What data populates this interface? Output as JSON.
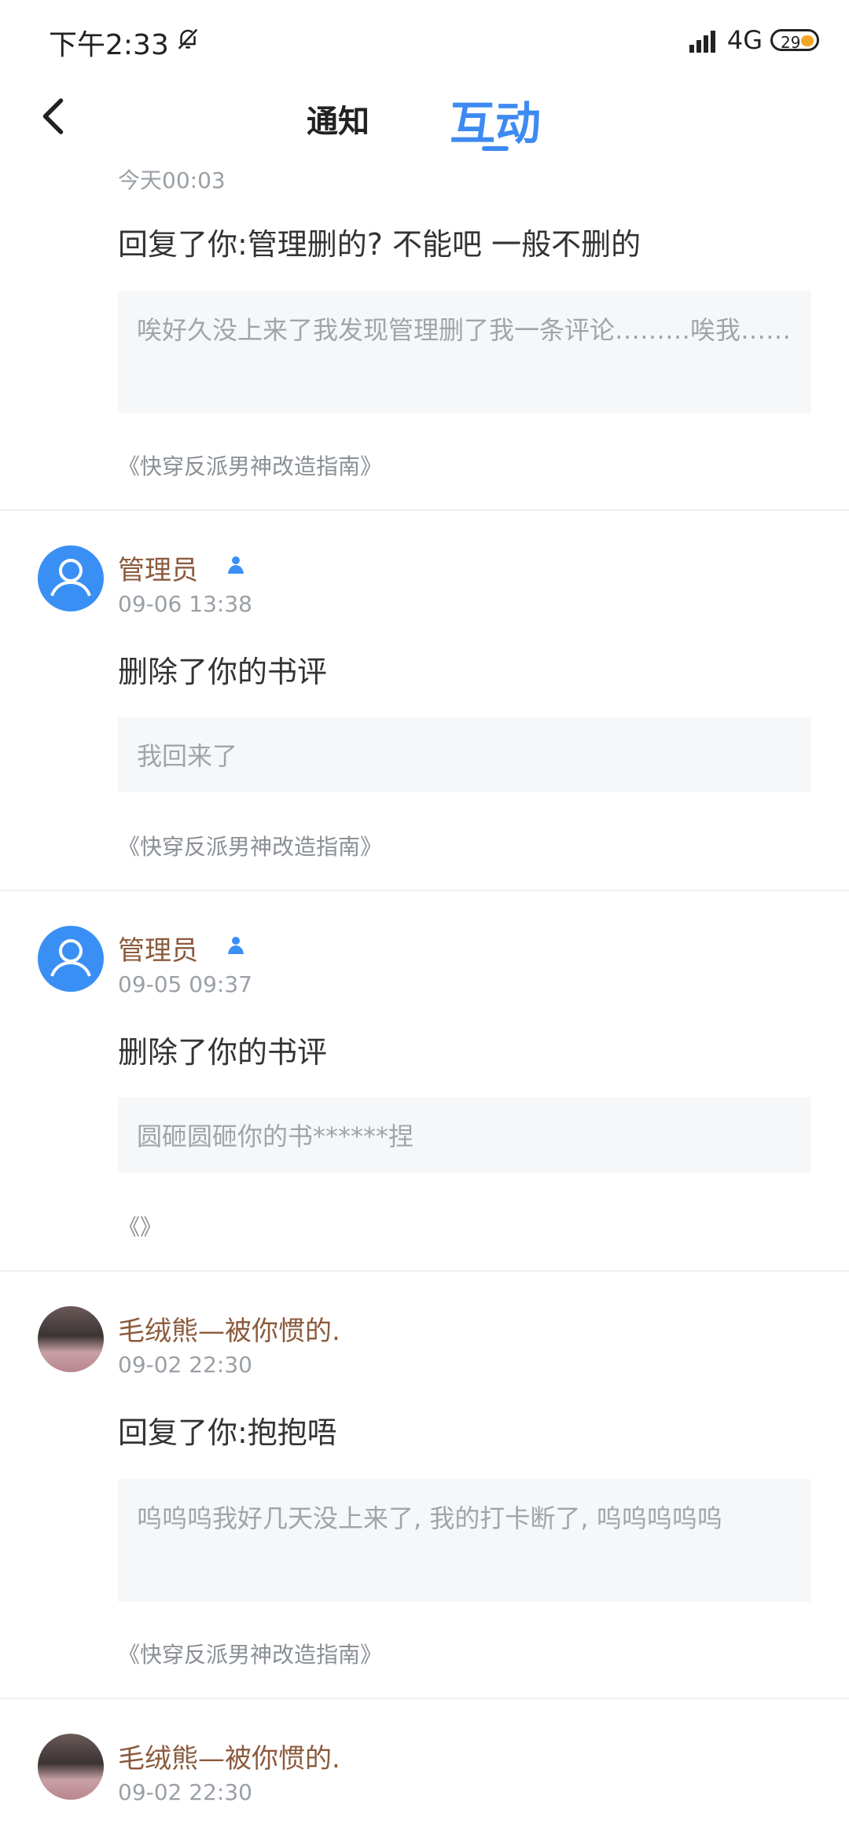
{
  "status_bar": {
    "time": "下午2:33",
    "network": "4G",
    "battery": "29"
  },
  "header": {
    "tab_notice": "通知",
    "tab_interaction": "互动"
  },
  "partial_item": {
    "time": "今天00:03",
    "action": "回复了你:管理删的? 不能吧 一般不删的",
    "quote": "唉好久没上来了我发现管理删了我一条评论………唉我……",
    "book": "《快穿反派男神改造指南》"
  },
  "items": [
    {
      "name": "管理员",
      "time": "09-06 13:38",
      "action": "删除了你的书评",
      "quote": "我回来了",
      "book": "《快穿反派男神改造指南》"
    },
    {
      "name": "管理员",
      "time": "09-05 09:37",
      "action": "删除了你的书评",
      "quote": "圆砸圆砸你的书******捏",
      "book": "《》"
    },
    {
      "name": "毛绒熊—被你惯的.",
      "time": "09-02 22:30",
      "action": "回复了你:抱抱唔",
      "quote": "呜呜呜我好几天没上来了, 我的打卡断了, 呜呜呜呜呜",
      "book": "《快穿反派男神改造指南》"
    },
    {
      "name": "毛绒熊—被你惯的.",
      "time": "09-02 22:30"
    }
  ],
  "icons": {
    "back": "chevron-left-icon",
    "mute": "bell-off-icon",
    "admin_badge": "admin-badge-icon",
    "default_avatar": "user-icon"
  },
  "colors": {
    "accent": "#3d8bf2",
    "name": "#8b5a3c",
    "quote_bg": "#f6f7f8"
  }
}
